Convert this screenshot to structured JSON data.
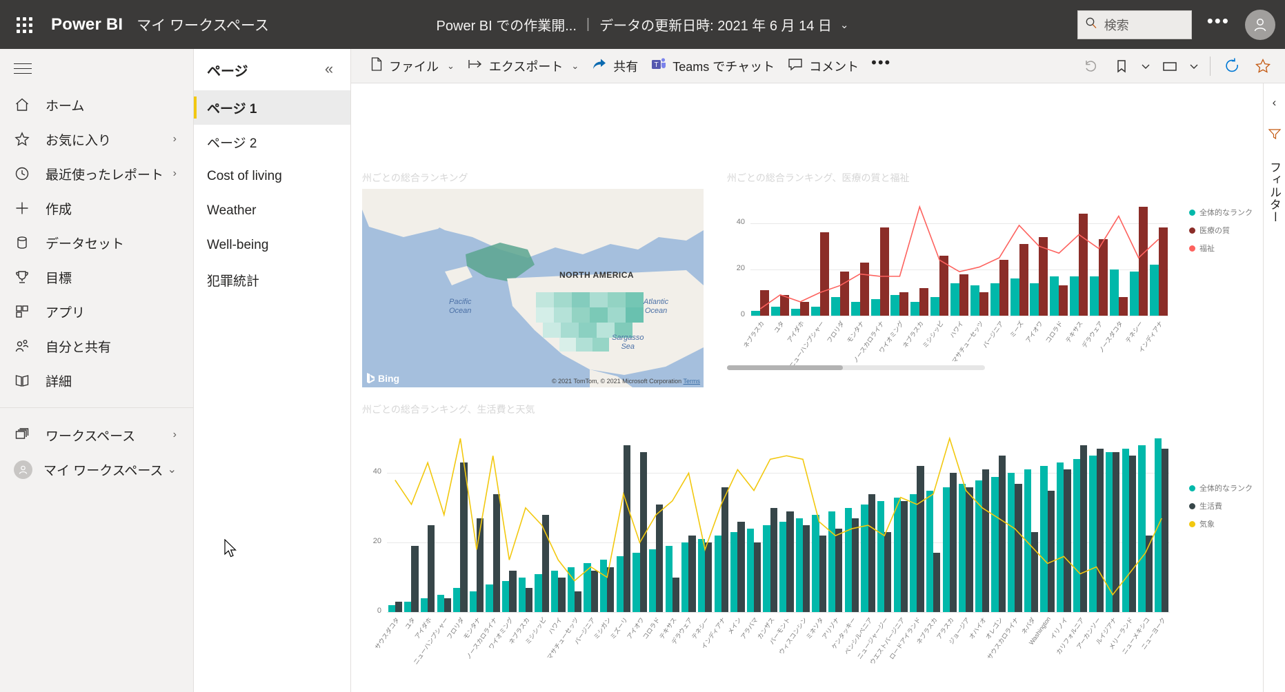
{
  "topbar": {
    "waffle_icon": "app-launcher-icon",
    "brand": "Power BI",
    "workspace": "マイ ワークスペース",
    "report_title": "Power BI での作業開...",
    "separator": "|",
    "refresh_info": "データの更新日時: 2021 年 6 月 14 日",
    "chevron": "⌄",
    "search_placeholder": "検索",
    "search_value": "",
    "more_label": "•••",
    "avatar_icon": "account-avatar-icon"
  },
  "sidebar": {
    "menu_icon": "hamburger-menu-icon",
    "items": [
      {
        "label": "ホーム",
        "icon": "home-icon",
        "chevron": ""
      },
      {
        "label": "お気に入り",
        "icon": "star-icon",
        "chevron": "›"
      },
      {
        "label": "最近使ったレポート",
        "icon": "clock-icon",
        "chevron": "›"
      },
      {
        "label": "作成",
        "icon": "plus-icon",
        "chevron": ""
      },
      {
        "label": "データセット",
        "icon": "database-icon",
        "chevron": ""
      },
      {
        "label": "目標",
        "icon": "trophy-icon",
        "chevron": ""
      },
      {
        "label": "アプリ",
        "icon": "apps-grid-icon",
        "chevron": ""
      },
      {
        "label": "自分と共有",
        "icon": "shared-people-icon",
        "chevron": ""
      },
      {
        "label": "詳細",
        "icon": "book-icon",
        "chevron": ""
      }
    ],
    "workspaces": [
      {
        "label": "ワークスペース",
        "icon": "workspaces-icon",
        "chevron": "›"
      },
      {
        "label": "マイ ワークスペース",
        "icon": "my-workspace-avatar-icon",
        "chevron": "⌄"
      }
    ]
  },
  "pages_pane": {
    "header": "ページ",
    "collapse_icon": "«",
    "items": [
      {
        "label": "ページ 1",
        "active": true
      },
      {
        "label": "ページ 2",
        "active": false
      },
      {
        "label": "Cost of living",
        "active": false
      },
      {
        "label": "Weather",
        "active": false
      },
      {
        "label": "Well-being",
        "active": false
      },
      {
        "label": "犯罪統計",
        "active": false
      }
    ]
  },
  "report_toolbar": {
    "buttons": [
      {
        "label": "ファイル",
        "icon": "file-icon",
        "has_chevron": true
      },
      {
        "label": "エクスポート",
        "icon": "export-icon",
        "has_chevron": true
      },
      {
        "label": "共有",
        "icon": "share-icon",
        "has_chevron": false
      },
      {
        "label": "Teams でチャット",
        "icon": "teams-icon",
        "has_chevron": false
      },
      {
        "label": "コメント",
        "icon": "comment-icon",
        "has_chevron": false
      }
    ],
    "overflow": "•••",
    "right_icons": [
      {
        "name": "reset-icon",
        "glyph": "↺",
        "has_chevron": false
      },
      {
        "name": "bookmark-icon",
        "glyph": "bookmark",
        "has_chevron": true
      },
      {
        "name": "view-icon",
        "glyph": "view",
        "has_chevron": true
      },
      {
        "name": "refresh-icon",
        "glyph": "↻",
        "has_chevron": false
      },
      {
        "name": "favorite-star-icon",
        "glyph": "☆",
        "has_chevron": false
      }
    ]
  },
  "right_rail": {
    "collapse_icon": "‹",
    "bookmarks_icon": "filter-pane-icon",
    "label": "フィルター"
  },
  "map_visual": {
    "title": "州ごとの総合ランキング",
    "north_america_label": "NORTH AMERICA",
    "pacific_label": "Pacific\nOcean",
    "atlantic_label": "Atlantic\nOcean",
    "sargasso_label": "Sargasso\nSea",
    "provider": "Bing",
    "attribution": "© 2021 TomTom, © 2021 Microsoft Corporation",
    "terms": "Terms"
  },
  "chart_data": [
    {
      "id": "health-welfare",
      "type": "bar",
      "title": "州ごとの総合ランキング、医療の質と福祉",
      "xlabel": "",
      "ylabel": "",
      "ylim": [
        0,
        50
      ],
      "yticks": [
        0,
        20,
        40
      ],
      "grid": true,
      "legend_position": "right",
      "categories": [
        "ネブラスカ",
        "ユタ",
        "アイダホ",
        "ニューハンプシャー",
        "フロリダ",
        "モンタナ",
        "ノースカロライナ",
        "ワイオミング",
        "ネブラスカ",
        "ミシシッピ",
        "ハワイ",
        "マサチューセッツ",
        "バージニア",
        "ミーズ",
        "アイオワ",
        "コロラド",
        "テキサス",
        "デラウェア",
        "ノースダコタ",
        "テネシー",
        "インディアナ"
      ],
      "series": [
        {
          "name": "全体的なランク",
          "color": "#01B8AA",
          "type": "bar",
          "values": [
            2,
            4,
            3,
            4,
            8,
            6,
            7,
            9,
            6,
            8,
            14,
            13,
            14,
            16,
            14,
            17,
            17,
            17,
            20,
            19,
            22
          ]
        },
        {
          "name": "医療の質",
          "color": "#8B2D28",
          "type": "bar",
          "values": [
            11,
            9,
            6,
            36,
            19,
            23,
            38,
            10,
            12,
            26,
            18,
            10,
            24,
            31,
            34,
            13,
            44,
            33,
            8,
            47,
            38
          ]
        },
        {
          "name": "福祉",
          "color": "#FD625E",
          "type": "line",
          "values": [
            3,
            9,
            6,
            10,
            13,
            18,
            17,
            17,
            47,
            24,
            19,
            21,
            25,
            39,
            30,
            27,
            35,
            29,
            43,
            25,
            33
          ]
        }
      ],
      "scrollbar": {
        "visible": true,
        "thumb_fraction": 0.45
      }
    },
    {
      "id": "cost-weather",
      "type": "bar",
      "title": "州ごとの総合ランキング、生活費と天気",
      "xlabel": "",
      "ylabel": "",
      "ylim": [
        0,
        52
      ],
      "yticks": [
        0,
        20,
        40
      ],
      "grid": true,
      "legend_position": "right",
      "categories": [
        "サウスダコタ",
        "ユタ",
        "アイダホ",
        "ニューハンプシャー",
        "フロリダ",
        "モンタナ",
        "ノースカロライナ",
        "ワイオミング",
        "ネブラスカ",
        "ミシシッピ",
        "ハワイ",
        "マサチューセッツ",
        "バージニア",
        "ミシガン",
        "ミズーリ",
        "アイオワ",
        "コロラド",
        "テキサス",
        "デラウェア",
        "テネシー",
        "インディアナ",
        "メイン",
        "アラバマ",
        "カンザス",
        "バーモント",
        "ウィスコンシン",
        "ミネソタ",
        "アリゾナ",
        "ケンタッキー",
        "ペンシルベニア",
        "ニュージャージー",
        "ウエストバージニア",
        "ロードアイランド",
        "ネブラスカ",
        "アラスカ",
        "ジョージア",
        "オハイオ",
        "オレゴン",
        "サウスカロライナ",
        "ネバダ",
        "Washington",
        "イリノイ",
        "カリフォルニア",
        "アーカンソー",
        "ルイジアナ",
        "メリーランド",
        "ニューメキシコ",
        "ニューヨーク"
      ],
      "series": [
        {
          "name": "全体的なランク",
          "color": "#01B8AA",
          "type": "bar",
          "values": [
            2,
            3,
            4,
            5,
            7,
            6,
            8,
            9,
            10,
            11,
            12,
            13,
            14,
            15,
            16,
            17,
            18,
            19,
            20,
            21,
            22,
            23,
            24,
            25,
            26,
            27,
            28,
            29,
            30,
            31,
            32,
            33,
            34,
            35,
            36,
            37,
            38,
            39,
            40,
            41,
            42,
            43,
            44,
            45,
            46,
            47,
            48,
            50
          ]
        },
        {
          "name": "生活費",
          "color": "#374649",
          "type": "bar",
          "values": [
            3,
            19,
            25,
            4,
            43,
            27,
            34,
            12,
            7,
            28,
            10,
            6,
            12,
            13,
            48,
            46,
            31,
            10,
            22,
            20,
            36,
            26,
            20,
            30,
            29,
            25,
            22,
            24,
            27,
            34,
            23,
            32,
            42,
            17,
            40,
            36,
            41,
            45,
            37,
            23,
            35,
            41,
            48,
            47,
            46,
            45,
            22,
            47
          ]
        },
        {
          "name": "気象",
          "color": "#F2C80F",
          "type": "line",
          "values": [
            38,
            31,
            43,
            28,
            50,
            18,
            45,
            15,
            30,
            25,
            15,
            9,
            13,
            10,
            34,
            20,
            28,
            32,
            40,
            18,
            31,
            41,
            35,
            44,
            45,
            44,
            26,
            22,
            24,
            25,
            22,
            33,
            31,
            34,
            50,
            35,
            30,
            27,
            24,
            19,
            14,
            16,
            11,
            13,
            5,
            11,
            17,
            27
          ]
        }
      ],
      "scrollbar": {
        "visible": false,
        "thumb_fraction": 1
      }
    }
  ]
}
